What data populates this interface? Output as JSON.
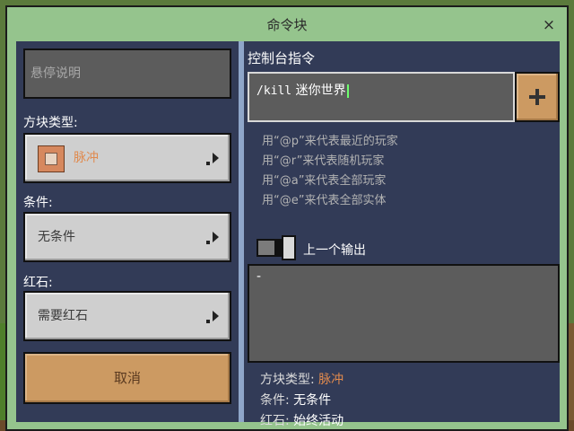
{
  "window": {
    "title": "命令块",
    "close_glyph": "×"
  },
  "left": {
    "hover_placeholder": "悬停说明",
    "block_type_label": "方块类型:",
    "block_type_value": "脉冲",
    "condition_label": "条件:",
    "condition_value": "无条件",
    "redstone_label": "红石:",
    "redstone_value": "需要红石",
    "cancel_label": "取消"
  },
  "right": {
    "console_label": "控制台指令",
    "command_text": "/kill",
    "command_rest": " 迷你世界",
    "add_glyph": "+",
    "hints": [
      "用“@p”来代表最近的玩家",
      "用“@r”来代表随机玩家",
      "用“@a”来代表全部玩家",
      "用“@e”来代表全部实体"
    ],
    "previous_output_label": "上一个输出",
    "output_text": "-",
    "summary": {
      "block_type_label": "方块类型: ",
      "block_type_value": "脉冲",
      "condition_label": "条件: ",
      "condition_value": "无条件",
      "redstone_label": "红石: ",
      "redstone_value": "始终活动"
    }
  },
  "colors": {
    "window_bg": "#95c48d",
    "panel_bg": "#323b57",
    "accent_orange": "#cc9a62",
    "value_orange": "#e08a4e"
  },
  "icons": [
    "command-block-icon",
    "chevron-right-icon",
    "plus-icon",
    "close-icon"
  ]
}
